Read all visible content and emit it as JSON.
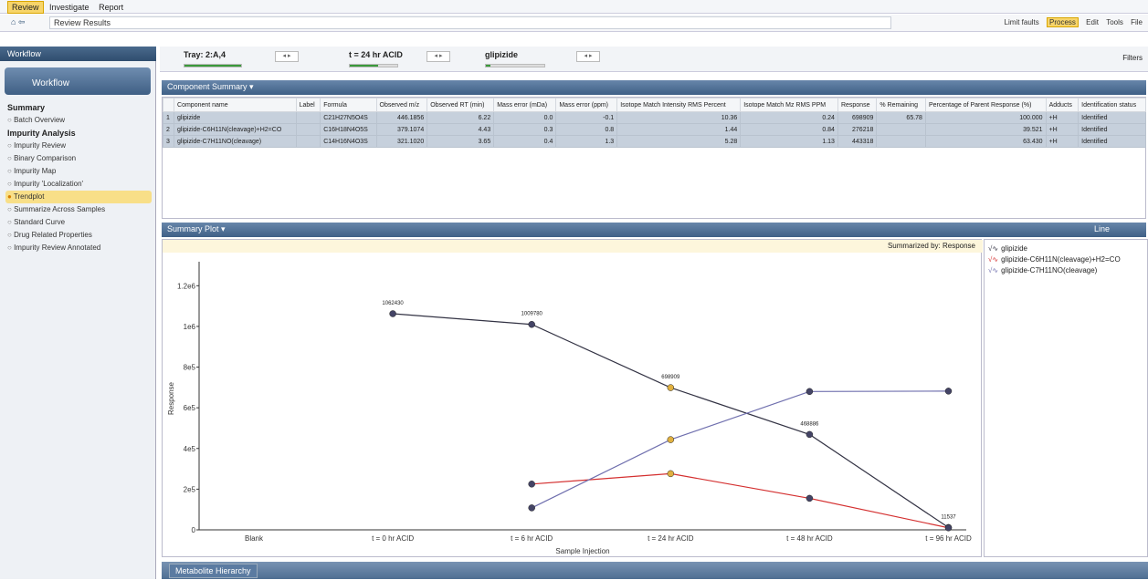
{
  "menu": {
    "tabs": [
      "Review",
      "Investigate",
      "Report"
    ]
  },
  "toolbar": {
    "address": "Review Results",
    "limit_faults": "Limit faults",
    "process": "Process",
    "edit": "Edit",
    "tools": "Tools",
    "file": "File",
    "filters": "Filters"
  },
  "left": {
    "panel_title": "Workflow",
    "workflow_label": "Workflow",
    "items": [
      {
        "label": "Summary",
        "type": "hd"
      },
      {
        "label": "Batch Overview",
        "type": "it"
      },
      {
        "label": "Impurity Analysis",
        "type": "hd"
      },
      {
        "label": "Impurity Review",
        "type": "it"
      },
      {
        "label": "Binary Comparison",
        "type": "it"
      },
      {
        "label": "Impurity Map",
        "type": "it"
      },
      {
        "label": "Impurity 'Localization'",
        "type": "it"
      },
      {
        "label": "Trendplot",
        "type": "sel"
      },
      {
        "label": "Summarize Across Samples",
        "type": "it"
      },
      {
        "label": "Standard Curve",
        "type": "it"
      },
      {
        "label": "Drug Related Properties",
        "type": "it"
      },
      {
        "label": "Impurity Review Annotated",
        "type": "it"
      }
    ]
  },
  "topbar": {
    "tray": "Tray: 2:A,4",
    "time": "t = 24 hr ACID",
    "compound": "glipizide"
  },
  "component_summary": {
    "title": "Component Summary ▾",
    "columns": [
      "",
      "Component name",
      "Label",
      "Formula",
      "Observed m/z",
      "Observed RT (min)",
      "Mass error (mDa)",
      "Mass error (ppm)",
      "Isotope Match Intensity RMS Percent",
      "Isotope Match Mz RMS PPM",
      "Response",
      "% Remaining",
      "Percentage of Parent Response (%)",
      "Adducts",
      "Identification status"
    ],
    "rows": [
      [
        "1",
        "glipizide",
        "",
        "C21H27N5O4S",
        "446.1856",
        "6.22",
        "0.0",
        "-0.1",
        "10.36",
        "0.24",
        "698909",
        "65.78",
        "100.000",
        "+H",
        "Identified"
      ],
      [
        "2",
        "glipizide-C6H11N(cleavage)+H2=CO",
        "",
        "C16H18N4O5S",
        "379.1074",
        "4.43",
        "0.3",
        "0.8",
        "1.44",
        "0.84",
        "276218",
        "",
        "39.521",
        "+H",
        "Identified"
      ],
      [
        "3",
        "glipizide-C7H11NO(cleavage)",
        "",
        "C14H16N4O3S",
        "321.1020",
        "3.65",
        "0.4",
        "1.3",
        "5.28",
        "1.13",
        "443318",
        "",
        "63.430",
        "+H",
        "Identified"
      ]
    ]
  },
  "plot": {
    "title": "Summary Plot ▾",
    "summarized": "Summarized by: Response",
    "mode": "Line"
  },
  "chart_data": {
    "type": "line",
    "xlabel": "Sample Injection",
    "ylabel": "Response",
    "categories": [
      "Blank",
      "t = 0 hr ACID",
      "t = 6 hr ACID",
      "t = 24 hr ACID",
      "t = 48 hr ACID",
      "t = 96 hr ACID"
    ],
    "yticks": [
      "0",
      "2e5",
      "4e5",
      "6e5",
      "8e5",
      "1e6",
      "1.2e6"
    ],
    "ylim": [
      0,
      1300000
    ],
    "series": [
      {
        "name": "glipizide",
        "color": "#333344",
        "values": [
          null,
          1062430,
          1009780,
          698909,
          468886,
          11537
        ],
        "labels": [
          null,
          "1062430",
          "1009780",
          "698909",
          "468886",
          "11537"
        ]
      },
      {
        "name": "glipizide-C6H11N(cleavage)+H2=CO",
        "color": "#d43030",
        "values": [
          null,
          null,
          225000,
          276218,
          155000,
          10000
        ],
        "labels": []
      },
      {
        "name": "glipizide-C7H11NO(cleavage)",
        "color": "#6f6fae",
        "values": [
          null,
          null,
          108000,
          443318,
          680000,
          682000
        ],
        "labels": []
      }
    ]
  },
  "bottom": {
    "tab": "Metabolite Hierarchy"
  }
}
